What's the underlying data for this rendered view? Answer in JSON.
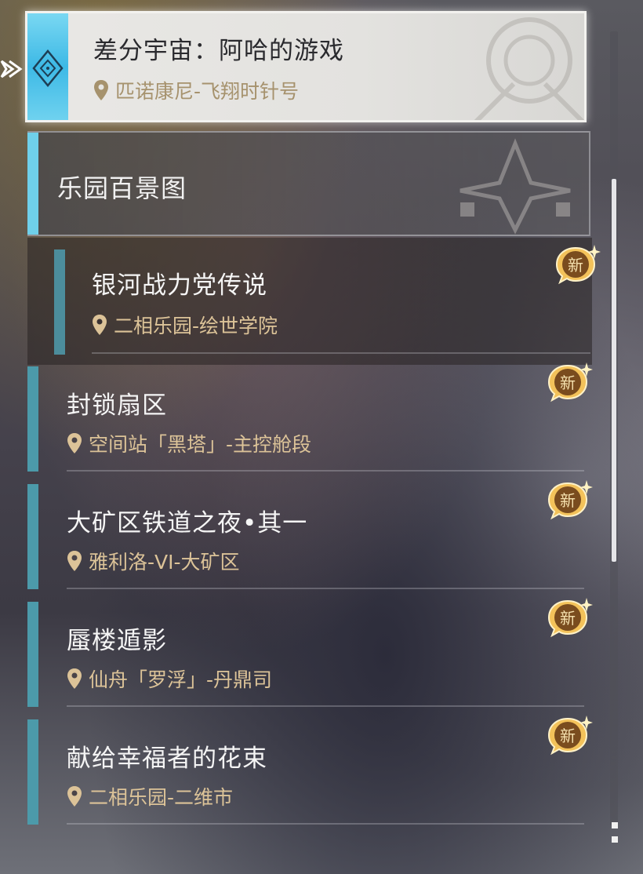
{
  "selected_quest": {
    "title": "差分宇宙：阿哈的游戏",
    "location": "匹诺康尼-飞翔时针号",
    "icon": "diamond-icon"
  },
  "category": {
    "title": "乐园百景图"
  },
  "badge_label": "新",
  "quests": [
    {
      "title": "银河战力党传说",
      "location": "二相乐园-绘世学院",
      "new": true,
      "highlighted": true
    },
    {
      "title": "封锁扇区",
      "location": "空间站「黑塔」-主控舱段",
      "new": true
    },
    {
      "title": "大矿区铁道之夜•其一",
      "location": "雅利洛-VI-大矿区",
      "new": true
    },
    {
      "title": "蜃楼遁影",
      "location": "仙舟「罗浮」-丹鼎司",
      "new": true
    },
    {
      "title": "献给幸福者的花束",
      "location": "二相乐园-二维市",
      "new": true
    }
  ],
  "colors": {
    "accent_cyan": "#6fd0ea",
    "accent_teal": "#4c9aaa",
    "location_gold": "#dcc398",
    "badge_gold": "#e8b34a"
  }
}
